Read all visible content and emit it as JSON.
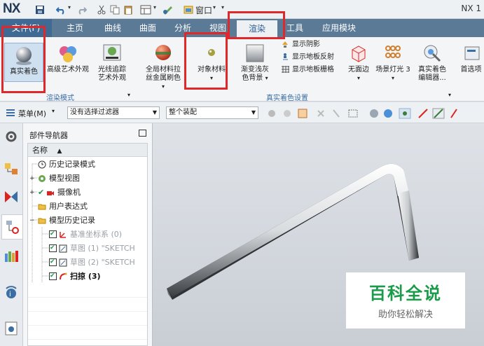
{
  "titlebar": {
    "logo": "NX",
    "window_menu": "窗口",
    "right_title": "NX 1"
  },
  "tabs": [
    {
      "label": "文件(F)"
    },
    {
      "label": "主页"
    },
    {
      "label": "曲线"
    },
    {
      "label": "曲面"
    },
    {
      "label": "分析"
    },
    {
      "label": "视图"
    },
    {
      "label": "渲染"
    },
    {
      "label": "工具"
    },
    {
      "label": "应用模块"
    }
  ],
  "ribbon": {
    "true_shading": "真实着色",
    "advanced_art": "高级艺术外观",
    "raytrace_line1": "光线追踪",
    "raytrace_line2": "艺术外观",
    "global_material_line1": "全局材料拉",
    "global_material_line2": "丝金属刷色",
    "object_material": "对象材料",
    "gradient_line1": "渐变浅灰",
    "gradient_line2": "色背景",
    "show_shadow": "显示阴影",
    "show_floor_reflect": "显示地板反射",
    "show_floor_grid": "显示地板栅格",
    "no_edge": "无面边",
    "scene_light": "场景灯光 3",
    "true_color_line1": "真实着色",
    "true_color_line2": "编辑器...",
    "preference": "首选项",
    "group_render_mode": "渲染模式",
    "group_true_shading_settings": "真实着色设置"
  },
  "toolbar2": {
    "menu": "菜单(M)",
    "filter": "没有选择过滤器",
    "assembly": "整个装配"
  },
  "navigator": {
    "title": "部件导航器",
    "column_name": "名称",
    "items": [
      {
        "label": "历史记录模式"
      },
      {
        "label": "模型视图"
      },
      {
        "label": "摄像机"
      },
      {
        "label": "用户表达式"
      },
      {
        "label": "模型历史记录"
      },
      {
        "label": "基准坐标系 (0)"
      },
      {
        "label": "草图 (1) \"SKETCH"
      },
      {
        "label": "草图 (2) \"SKETCH"
      },
      {
        "label": "扫掠 (3)"
      }
    ]
  },
  "watermark": {
    "line1": "百科全说",
    "line2": "助你轻松解决"
  },
  "colors": {
    "tabbar": "#5b7a96",
    "accent_blue": "#3b6ea5",
    "highlight_red": "#e0282b",
    "watermark_green": "#1a9b4a"
  }
}
